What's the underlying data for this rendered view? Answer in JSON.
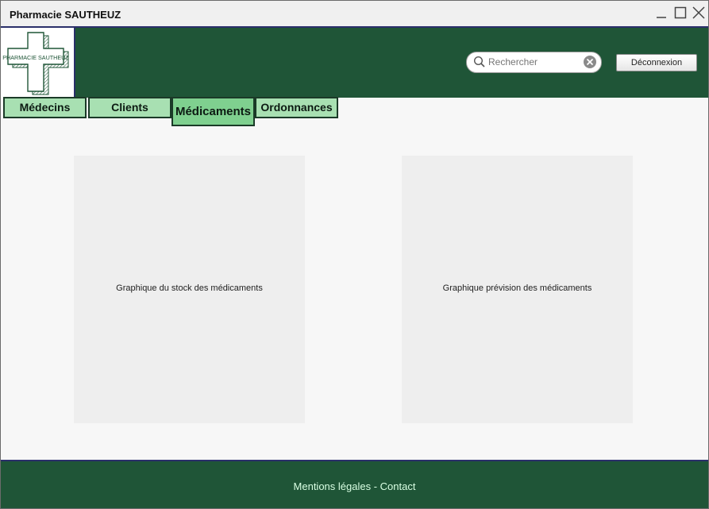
{
  "window": {
    "title": "Pharmacie SAUTHEUZ",
    "controls": [
      {
        "name": "minimize-icon"
      },
      {
        "name": "maximize-icon"
      },
      {
        "name": "close-icon"
      }
    ]
  },
  "header": {
    "logo_text": "PHARMACIE SAUTHEUZ",
    "search": {
      "placeholder": "Rechercher",
      "value": ""
    },
    "logout_label": "Déconnexion"
  },
  "tabs": [
    {
      "label": "Médecins",
      "active": false
    },
    {
      "label": "Clients",
      "active": false
    },
    {
      "label": "Médicaments",
      "active": true
    },
    {
      "label": "Ordonnances",
      "active": false
    }
  ],
  "main": {
    "panels": [
      {
        "label": "Graphique du stock des médicaments"
      },
      {
        "label": "Graphique prévision des médicaments"
      }
    ]
  },
  "footer": {
    "text": "Mentions légales - Contact"
  },
  "colors": {
    "header_bg": "#1f5537",
    "tab_bg": "#a8e0b2",
    "tab_active_bg": "#7fd08f",
    "border_accent": "#2a2f6a",
    "panel_bg": "#eeeeee"
  }
}
